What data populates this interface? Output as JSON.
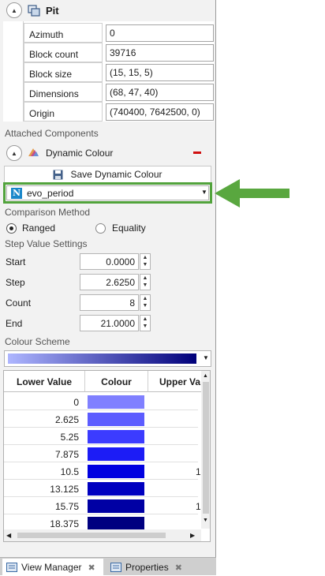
{
  "pit": {
    "title": "Pit"
  },
  "properties": [
    {
      "name": "Azimuth",
      "value": "0"
    },
    {
      "name": "Block count",
      "value": "39716"
    },
    {
      "name": "Block size",
      "value": "(15, 15, 5)"
    },
    {
      "name": "Dimensions",
      "value": "(68, 47, 40)"
    },
    {
      "name": "Origin",
      "value": "(740400, 7642500, 0)"
    }
  ],
  "attached": {
    "section_label": "Attached Components",
    "component_label": "Dynamic Colour",
    "remove_icon": "minus-icon",
    "remove_color": "#d01010"
  },
  "save_button": {
    "label": "Save Dynamic Colour"
  },
  "attribute_select": {
    "value": "evo_period",
    "icon_letter": "N"
  },
  "comparison": {
    "label": "Comparison Method",
    "options": [
      {
        "label": "Ranged",
        "selected": true
      },
      {
        "label": "Equality",
        "selected": false
      }
    ]
  },
  "step_settings": {
    "label": "Step Value Settings",
    "fields": [
      {
        "label": "Start",
        "value": "0.0000"
      },
      {
        "label": "Step",
        "value": "2.6250"
      },
      {
        "label": "Count",
        "value": "8"
      },
      {
        "label": "End",
        "value": "21.0000"
      }
    ]
  },
  "colour_scheme": {
    "label": "Colour Scheme",
    "from": "#aeb6ff",
    "to": "#00007a"
  },
  "colour_table": {
    "headers": [
      "Lower Value",
      "Colour",
      "Upper Va"
    ],
    "rows": [
      {
        "lower": "0",
        "colour": "#8080ff",
        "upper": ""
      },
      {
        "lower": "2.625",
        "colour": "#5c5cff",
        "upper": ""
      },
      {
        "lower": "5.25",
        "colour": "#3c3cff",
        "upper": ""
      },
      {
        "lower": "7.875",
        "colour": "#1c1cf6",
        "upper": ""
      },
      {
        "lower": "10.5",
        "colour": "#0000e0",
        "upper": "1"
      },
      {
        "lower": "13.125",
        "colour": "#0000c0",
        "upper": ""
      },
      {
        "lower": "15.75",
        "colour": "#0000a4",
        "upper": "1"
      },
      {
        "lower": "18.375",
        "colour": "#000080",
        "upper": ""
      }
    ]
  },
  "tabs": [
    {
      "label": "View Manager",
      "active": true
    },
    {
      "label": "Properties",
      "active": false
    }
  ],
  "accent": {
    "highlight": "#52a33c",
    "arrow": "#59a73f"
  }
}
